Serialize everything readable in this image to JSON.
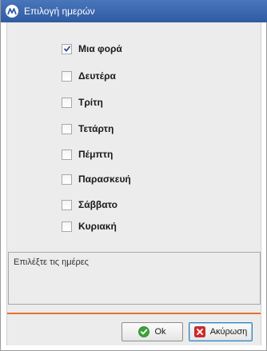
{
  "window": {
    "title": "Επιλογή ημερών",
    "app_icon": "app-logo-icon"
  },
  "options": [
    {
      "label": "Μια φορά",
      "checked": true
    },
    {
      "label": "Δευτέρα",
      "checked": false
    },
    {
      "label": "Τρίτη",
      "checked": false
    },
    {
      "label": "Τετάρτη",
      "checked": false
    },
    {
      "label": "Πέμπτη",
      "checked": false
    },
    {
      "label": "Παρασκευή",
      "checked": false
    },
    {
      "label": "Σάββατο",
      "checked": false
    },
    {
      "label": "Κυριακή",
      "checked": false
    }
  ],
  "info": {
    "text": "Επιλέξτε τις ημέρες"
  },
  "buttons": {
    "ok_label": "Ok",
    "ok_icon": "green-check-icon",
    "cancel_label": "Ακύρωση",
    "cancel_icon": "red-x-icon"
  },
  "colors": {
    "titlebar": "#2e5ba2",
    "separator": "#e8702c",
    "ok_icon": "#3aa335",
    "cancel_icon": "#d42a2a"
  }
}
